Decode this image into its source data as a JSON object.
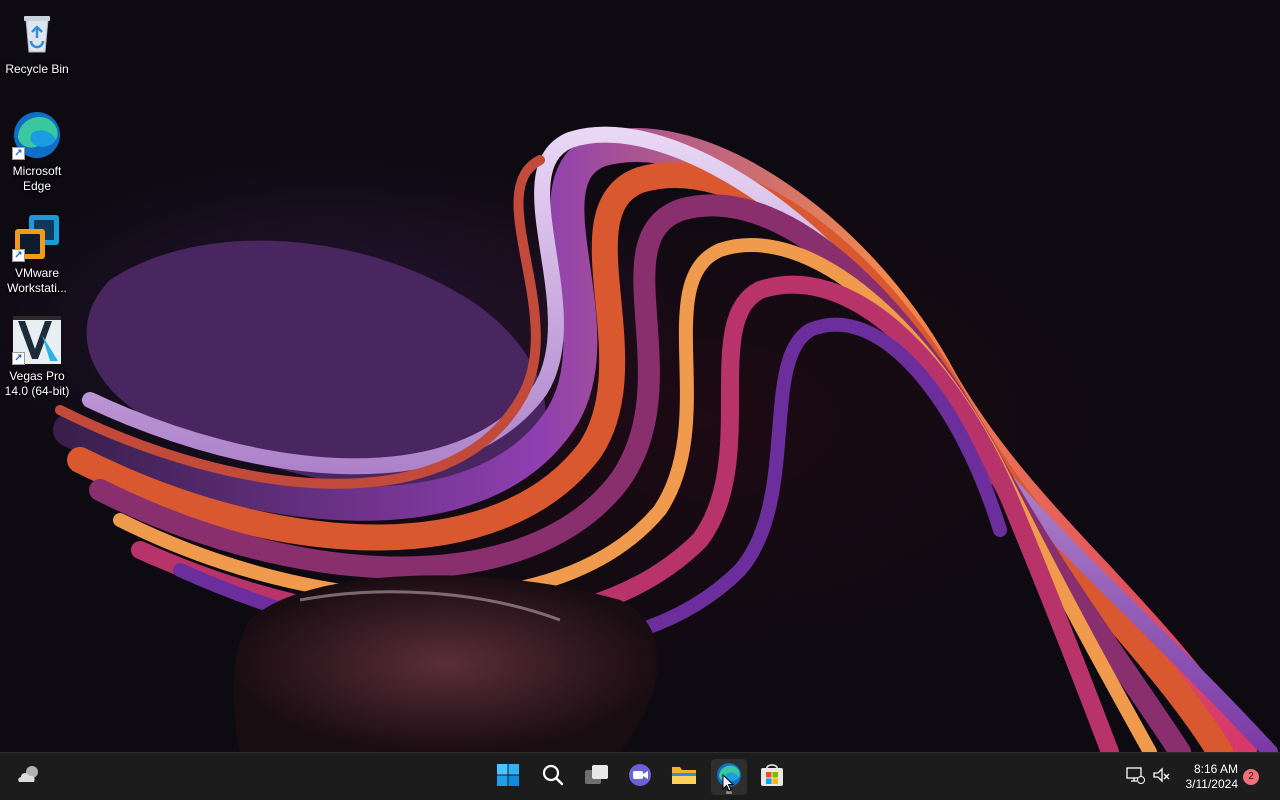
{
  "desktop": {
    "icons": [
      {
        "label": "Recycle Bin",
        "icon": "recycle-bin-icon"
      },
      {
        "label": "Microsoft Edge",
        "icon": "edge-icon"
      },
      {
        "label": "VMware Workstati...",
        "icon": "vmware-icon"
      },
      {
        "label": "Vegas Pro 14.0 (64-bit)",
        "icon": "vegas-pro-icon"
      }
    ]
  },
  "taskbar": {
    "widgets_icon": "weather-widget-icon",
    "apps": [
      {
        "name": "Start",
        "icon": "windows-start-icon"
      },
      {
        "name": "Search",
        "icon": "search-icon"
      },
      {
        "name": "Task View",
        "icon": "task-view-icon"
      },
      {
        "name": "Chat",
        "icon": "teams-chat-icon"
      },
      {
        "name": "File Explorer",
        "icon": "file-explorer-icon"
      },
      {
        "name": "Microsoft Edge",
        "icon": "edge-icon",
        "active": true
      },
      {
        "name": "Microsoft Store",
        "icon": "store-icon"
      }
    ],
    "tray": {
      "network_icon": "network-disconnected-icon",
      "volume_icon": "volume-muted-icon",
      "time": "8:16 AM",
      "date": "3/11/2024",
      "notification_count": "2"
    }
  },
  "colors": {
    "taskbar_bg": "#1c1c1c",
    "accent_blue": "#0078d4",
    "notification_badge": "#f1707b"
  }
}
